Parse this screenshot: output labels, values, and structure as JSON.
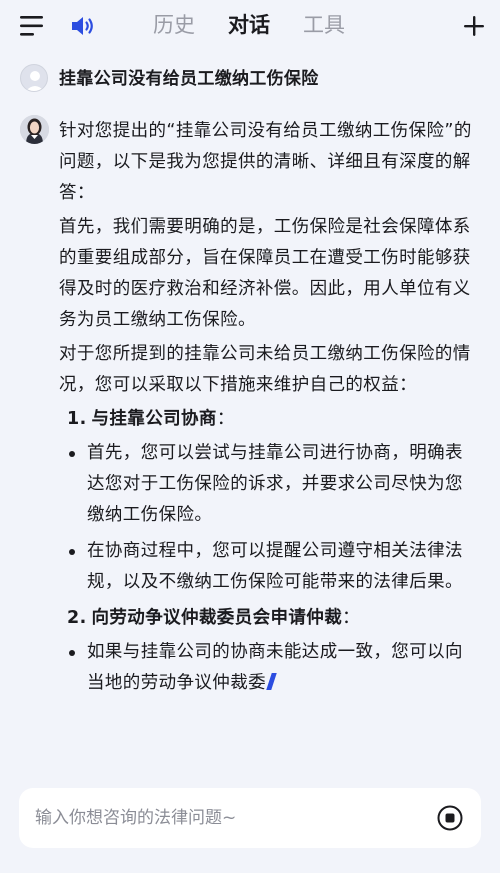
{
  "header": {
    "tabs": [
      {
        "label": "历史",
        "active": false
      },
      {
        "label": "对话",
        "active": true
      },
      {
        "label": "工具",
        "active": false
      }
    ],
    "icons": [
      "menu-icon",
      "speaker-icon",
      "plus-icon"
    ]
  },
  "question": {
    "text": "挂靠公司没有给员工缴纳工伤保险"
  },
  "answer": {
    "intro": "针对您提出的“挂靠公司没有给员工缴纳工伤保险”的问题，以下是我为您提供的清晰、详细且有深度的解答：",
    "para1": "首先，我们需要明确的是，工伤保险是社会保障体系的重要组成部分，旨在保障员工在遭受工伤时能够获得及时的医疗救治和经济补偿。因此，用人单位有义务为员工缴纳工伤保险。",
    "para2": "对于您所提到的挂靠公司未给员工缴纳工伤保险的情况，您可以采取以下措施来维护自己的权益：",
    "sections": [
      {
        "number": "1.",
        "title": "与挂靠公司协商",
        "suffix": "：",
        "bullets": [
          "首先，您可以尝试与挂靠公司进行协商，明确表达您对于工伤保险的诉求，并要求公司尽快为您缴纳工伤保险。",
          "在协商过程中，您可以提醒公司遵守相关法律法规，以及不缴纳工伤保险可能带来的法律后果。"
        ]
      },
      {
        "number": "2.",
        "title": "向劳动争议仲裁委员会申请仲裁",
        "suffix": "：",
        "bullets": [
          "如果与挂靠公司的协商未能达成一致，您可以向当地的劳动争议仲裁委"
        ]
      }
    ]
  },
  "input": {
    "placeholder": "输入你想咨询的法律问题~",
    "value": ""
  },
  "colors": {
    "background": "#f2f4fa",
    "accent": "#2c4de0",
    "text": "#1b1b1f",
    "muted": "#9a9ca6"
  }
}
